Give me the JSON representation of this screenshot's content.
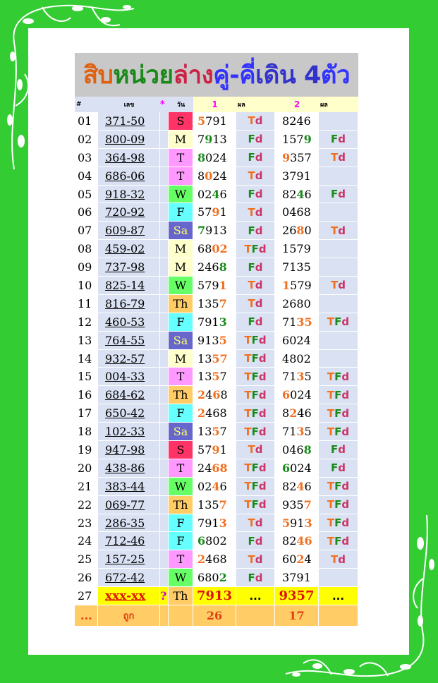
{
  "title": {
    "parts": [
      {
        "text": "สิบ",
        "color": "#e06010"
      },
      {
        "text": "หน่วย",
        "color": "#1a8a1a"
      },
      {
        "text": "ล่าง ",
        "color": "#cc2244"
      },
      {
        "text": "คู่-คี่ ",
        "color": "#3333ff"
      },
      {
        "text": "เดิน 4 ",
        "color": "#3333cc"
      },
      {
        "text": "ตัว",
        "color": "#3333ff"
      }
    ]
  },
  "header": {
    "hash": "#",
    "num": "เลข",
    "star": "*",
    "day": "วัน",
    "set1": "1",
    "res1": "ผล",
    "set2": "2",
    "res2": "ผล"
  },
  "rows": [
    {
      "no": "01",
      "num": "371-50",
      "day": "S",
      "d1": "5791",
      "h1": [
        0
      ],
      "r1": [
        "T",
        "d"
      ],
      "d2": "8246",
      "h2": [],
      "r2": []
    },
    {
      "no": "02",
      "num": "800-09",
      "day": "M",
      "d1": "7913",
      "h1": [
        1
      ],
      "r1": [
        "F",
        "d"
      ],
      "d2": "1579",
      "h2": [
        3
      ],
      "r2": [
        "F",
        "d"
      ]
    },
    {
      "no": "03",
      "num": "364-98",
      "day": "T",
      "d1": "8024",
      "h1": [
        0
      ],
      "r1": [
        "F",
        "d"
      ],
      "d2": "9357",
      "h2": [
        0
      ],
      "r2": [
        "T",
        "d"
      ]
    },
    {
      "no": "04",
      "num": "686-06",
      "day": "T",
      "d1": "8024",
      "h1": [
        1
      ],
      "r1": [
        "T",
        "d"
      ],
      "d2": "3791",
      "h2": [],
      "r2": []
    },
    {
      "no": "05",
      "num": "918-32",
      "day": "W",
      "d1": "0246",
      "h1": [
        2
      ],
      "r1": [
        "F",
        "d"
      ],
      "d2": "8246",
      "h2": [
        2
      ],
      "r2": [
        "F",
        "d"
      ]
    },
    {
      "no": "06",
      "num": "720-92",
      "day": "F",
      "d1": "5791",
      "h1": [
        2
      ],
      "r1": [
        "T",
        "d"
      ],
      "d2": "0468",
      "h2": [],
      "r2": []
    },
    {
      "no": "07",
      "num": "609-87",
      "day": "Sa",
      "d1": "7913",
      "h1": [
        0
      ],
      "r1": [
        "F",
        "d"
      ],
      "d2": "2680",
      "h2": [
        2
      ],
      "r2": [
        "T",
        "d"
      ]
    },
    {
      "no": "08",
      "num": "459-02",
      "day": "M",
      "d1": "6802",
      "h1": [
        2,
        3
      ],
      "r1": [
        "T",
        "F",
        "d"
      ],
      "d2": "1579",
      "h2": [],
      "r2": []
    },
    {
      "no": "09",
      "num": "737-98",
      "day": "M",
      "d1": "2468",
      "h1": [
        3
      ],
      "r1": [
        "F",
        "d"
      ],
      "d2": "7135",
      "h2": [],
      "r2": []
    },
    {
      "no": "10",
      "num": "825-14",
      "day": "W",
      "d1": "5791",
      "h1": [
        3
      ],
      "r1": [
        "T",
        "d"
      ],
      "d2": "1579",
      "h2": [
        0
      ],
      "r2": [
        "T",
        "d"
      ]
    },
    {
      "no": "11",
      "num": "816-79",
      "day": "Th",
      "d1": "1357",
      "h1": [
        3
      ],
      "r1": [
        "T",
        "d"
      ],
      "d2": "2680",
      "h2": [],
      "r2": []
    },
    {
      "no": "12",
      "num": "460-53",
      "day": "F",
      "d1": "7913",
      "h1": [
        3
      ],
      "r1": [
        "F",
        "d"
      ],
      "d2": "7135",
      "h2": [
        2,
        3
      ],
      "r2": [
        "T",
        "F",
        "d"
      ]
    },
    {
      "no": "13",
      "num": "764-55",
      "day": "Sa",
      "d1": "9135",
      "h1": [
        3
      ],
      "r1": [
        "T",
        "F",
        "d"
      ],
      "d2": "6024",
      "h2": [],
      "r2": []
    },
    {
      "no": "14",
      "num": "932-57",
      "day": "M",
      "d1": "1357",
      "h1": [
        2,
        3
      ],
      "r1": [
        "T",
        "F",
        "d"
      ],
      "d2": "4802",
      "h2": [],
      "r2": []
    },
    {
      "no": "15",
      "num": "004-33",
      "day": "T",
      "d1": "1357",
      "h1": [
        2
      ],
      "r1": [
        "T",
        "F",
        "d"
      ],
      "d2": "7135",
      "h2": [
        2
      ],
      "r2": [
        "T",
        "F",
        "d"
      ]
    },
    {
      "no": "16",
      "num": "684-62",
      "day": "Th",
      "d1": "2468",
      "h1": [
        0,
        2
      ],
      "r1": [
        "T",
        "F",
        "d"
      ],
      "d2": "6024",
      "h2": [
        0
      ],
      "r2": [
        "T",
        "F",
        "d"
      ]
    },
    {
      "no": "17",
      "num": "650-42",
      "day": "F",
      "d1": "2468",
      "h1": [
        0
      ],
      "r1": [
        "T",
        "F",
        "d"
      ],
      "d2": "8246",
      "h2": [
        1
      ],
      "r2": [
        "T",
        "F",
        "d"
      ]
    },
    {
      "no": "18",
      "num": "102-33",
      "day": "Sa",
      "d1": "1357",
      "h1": [
        2
      ],
      "r1": [
        "T",
        "F",
        "d"
      ],
      "d2": "7135",
      "h2": [
        2
      ],
      "r2": [
        "T",
        "F",
        "d"
      ]
    },
    {
      "no": "19",
      "num": "947-98",
      "day": "S",
      "d1": "5791",
      "h1": [
        2
      ],
      "r1": [
        "T",
        "d"
      ],
      "d2": "0468",
      "h2": [
        3
      ],
      "r2": [
        "F",
        "d"
      ]
    },
    {
      "no": "20",
      "num": "438-86",
      "day": "T",
      "d1": "2468",
      "h1": [
        2,
        3
      ],
      "r1": [
        "T",
        "F",
        "d"
      ],
      "d2": "6024",
      "h2": [
        0
      ],
      "r2": [
        "F",
        "d"
      ]
    },
    {
      "no": "21",
      "num": "383-44",
      "day": "W",
      "d1": "0246",
      "h1": [
        2
      ],
      "r1": [
        "T",
        "F",
        "d"
      ],
      "d2": "8246",
      "h2": [
        2
      ],
      "r2": [
        "T",
        "F",
        "d"
      ]
    },
    {
      "no": "22",
      "num": "069-77",
      "day": "Th",
      "d1": "1357",
      "h1": [
        3
      ],
      "r1": [
        "T",
        "F",
        "d"
      ],
      "d2": "9357",
      "h2": [
        3
      ],
      "r2": [
        "T",
        "F",
        "d"
      ]
    },
    {
      "no": "23",
      "num": "286-35",
      "day": "F",
      "d1": "7913",
      "h1": [
        3
      ],
      "r1": [
        "T",
        "d"
      ],
      "d2": "5913",
      "h2": [
        0,
        3
      ],
      "r2": [
        "T",
        "F",
        "d"
      ]
    },
    {
      "no": "24",
      "num": "712-46",
      "day": "F",
      "d1": "6802",
      "h1": [
        0
      ],
      "r1": [
        "F",
        "d"
      ],
      "d2": "8246",
      "h2": [
        2,
        3
      ],
      "r2": [
        "T",
        "F",
        "d"
      ]
    },
    {
      "no": "25",
      "num": "157-25",
      "day": "T",
      "d1": "2468",
      "h1": [
        0
      ],
      "r1": [
        "T",
        "d"
      ],
      "d2": "6024",
      "h2": [
        2
      ],
      "r2": [
        "T",
        "d"
      ]
    },
    {
      "no": "26",
      "num": "672-42",
      "day": "W",
      "d1": "6802",
      "h1": [
        3
      ],
      "r1": [
        "F",
        "d"
      ],
      "d2": "3791",
      "h2": [],
      "r2": []
    }
  ],
  "row27": {
    "no": "27",
    "num": "xxx-xx",
    "q": "?",
    "day": "Th",
    "d1": "7913",
    "r1": "...",
    "d2": "9357",
    "r2": "..."
  },
  "summary": {
    "no": "...",
    "label": "ถูก",
    "count1": "26",
    "count2": "17"
  }
}
